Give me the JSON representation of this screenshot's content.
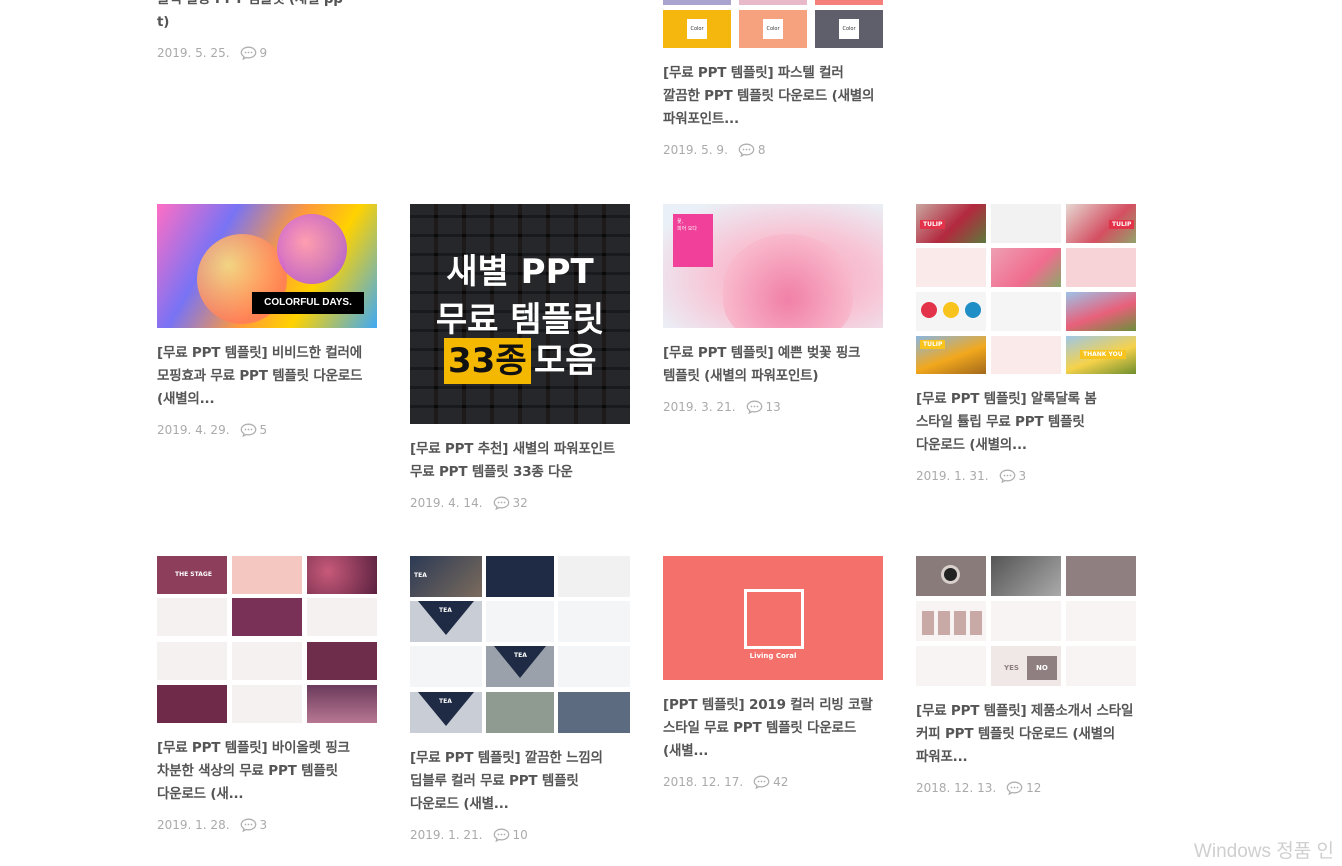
{
  "top": {
    "card1": {
      "title_partial": "블랙 활용 PPT 템플릿 (새별 pp\nt)",
      "date": "2019. 5. 25.",
      "comments": "9"
    },
    "card3": {
      "swatch_labels": [
        "Color",
        "Color",
        "Color"
      ],
      "title": "[무료 PPT 템플릿] 파스텔 컬러 깔끔한 PPT 템플릿 다운로드 (새별의 파워포인트...",
      "date": "2019. 5. 9.",
      "comments": "8"
    }
  },
  "row2": [
    {
      "thumb_text": "COLORFUL DAYS.",
      "title": "[무료 PPT 템플릿] 비비드한 컬러에 모핑효과 무료 PPT 템플릿 다운로드 (새별의...",
      "date": "2019. 4. 29.",
      "comments": "5"
    },
    {
      "thumb_line1": "새별 PPT",
      "thumb_line2": "무료 템플릿",
      "thumb_line3a": "33종",
      "thumb_line3b": "모음",
      "title": "[무료 PPT 추천] 새별의 파워포인트 무료 PPT 템플릿 33종 다운",
      "date": "2019. 4. 14.",
      "comments": "32"
    },
    {
      "thumb_text": "꽃,\n피어 오다",
      "title": "[무료 PPT 템플릿] 예쁜 벚꽃 핑크 템플릿 (새별의 파워포인트)",
      "date": "2019. 3. 21.",
      "comments": "13"
    },
    {
      "thumb_labels": [
        "TULIP",
        "TULIP",
        "THANK YOU",
        "TULIP"
      ],
      "title": "[무료 PPT 템플릿] 알록달록 봄 스타일 튤립 무료 PPT 템플릿 다운로드 (새별의...",
      "date": "2019. 1. 31.",
      "comments": "3"
    }
  ],
  "row3": [
    {
      "thumb_label": "THE STAGE",
      "title": "[무료 PPT 템플릿] 바이올렛 핑크 차분한 색상의 무료 PPT 템플릿 다운로드 (새...",
      "date": "2019. 1. 28.",
      "comments": "3"
    },
    {
      "thumb_labels": [
        "TEA",
        "TEA",
        "TEA",
        "TEA"
      ],
      "title": "[무료 PPT 템플릿] 깔끔한 느낌의 딥블루 컬러 무료 PPT 템플릿 다운로드 (새별...",
      "date": "2019. 1. 21.",
      "comments": "10"
    },
    {
      "thumb_text": "Living Coral",
      "title": "[PPT 템플릿] 2019 컬러 리빙 코랄 스타일 무료 PPT 템플릿 다운로드 (새별...",
      "date": "2018. 12. 17.",
      "comments": "42"
    },
    {
      "thumb_labels": [
        "YES",
        "NO"
      ],
      "title": "[무료 PPT 템플릿] 제품소개서 스타일 커피 PPT 템플릿 다운로드 (새별의 파워포...",
      "date": "2018. 12. 13.",
      "comments": "12"
    }
  ],
  "watermark": "Windows 정품 인"
}
